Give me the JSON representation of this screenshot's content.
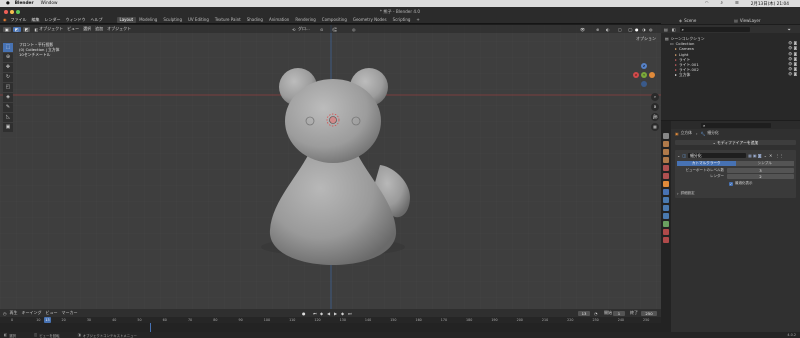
{
  "macbar": {
    "app": "Blender",
    "window_menu": "Window",
    "clock": "2月13日(木) 21:04"
  },
  "titlebar": {
    "title": "* 熊子 - Blender 4.0"
  },
  "topmenu": {
    "items": [
      "ファイル",
      "編集",
      "レンダー",
      "ウィンドウ",
      "ヘルプ"
    ],
    "workspaces": [
      "Layout",
      "Modeling",
      "Sculpting",
      "UV Editing",
      "Texture Paint",
      "Shading",
      "Animation",
      "Rendering",
      "Compositing",
      "Geometry Nodes",
      "Scripting"
    ],
    "active_workspace": "Layout",
    "scene_label": "Scene",
    "viewlayer_label": "ViewLayer"
  },
  "viewport": {
    "mode": "オブジェクト",
    "menus": [
      "ビュー",
      "選択",
      "追加",
      "オブジェクト"
    ],
    "orientation": "グロ...",
    "options_label": "オプション",
    "info_line1": "フロント・平行投影",
    "info_line2": "(0) Collection | 立方体",
    "info_line3": "10センチメートル",
    "tool_icons": [
      "select-icon",
      "cursor-icon",
      "move-icon",
      "rotate-icon",
      "scale-icon",
      "transform-icon",
      "annotate-icon",
      "measure-icon",
      "add-cube-icon"
    ],
    "gizmo_z": "Z",
    "gizmo_x": "X",
    "gizmo_y": "Y"
  },
  "outliner": {
    "title": "シーンコレクション",
    "rows": [
      {
        "label": "シーンコレクション",
        "indent": 0,
        "color": "#cfcfcf"
      },
      {
        "label": "Collection",
        "indent": 1,
        "color": "#cfcfcf"
      },
      {
        "label": "Camera",
        "indent": 2,
        "color": "#e0a870"
      },
      {
        "label": "Light",
        "indent": 2,
        "color": "#e0a870"
      },
      {
        "label": "ライト",
        "indent": 2,
        "color": "#c86262"
      },
      {
        "label": "ライト.001",
        "indent": 2,
        "color": "#c86262"
      },
      {
        "label": "ライト.002",
        "indent": 2,
        "color": "#c86262"
      },
      {
        "label": "立方体",
        "indent": 2,
        "color": "#e6e6e6"
      }
    ]
  },
  "properties": {
    "breadcrumb_obj": "立方体",
    "breadcrumb_mod": "細分化",
    "add_modifier": "モディファイアーを追加",
    "modifier_name": "細分化",
    "mode_catmull": "カトマルクラーク",
    "mode_simple": "シンプル",
    "levels_viewport_label": "ビューポートのレベル数",
    "levels_viewport_value": "3",
    "render_label": "レンダー",
    "render_value": "2",
    "optimal_display": "最適化表示",
    "advanced": "詳細設定"
  },
  "timeline": {
    "menus": [
      "再生",
      "キーイング",
      "ビュー",
      "マーカー"
    ],
    "current_frame": "13",
    "start_label": "開始",
    "start": "1",
    "end_label": "終了",
    "end": "250",
    "ticks": [
      "0",
      "10",
      "20",
      "30",
      "40",
      "50",
      "60",
      "70",
      "80",
      "90",
      "100",
      "110",
      "120",
      "130",
      "140",
      "150",
      "160",
      "170",
      "180",
      "190",
      "200",
      "210",
      "220",
      "230",
      "240",
      "250"
    ]
  },
  "statusbar": {
    "item1": "選択",
    "item2": "ビューを回転",
    "item3": "オブジェクトコンテキストメニュー",
    "version": "4.0.2"
  },
  "colors": {
    "accent": "#4772b3",
    "viewport_bg": "#3e3e3e",
    "x_axis": "#a04b4b",
    "y_axis": "#4b6fa0"
  }
}
